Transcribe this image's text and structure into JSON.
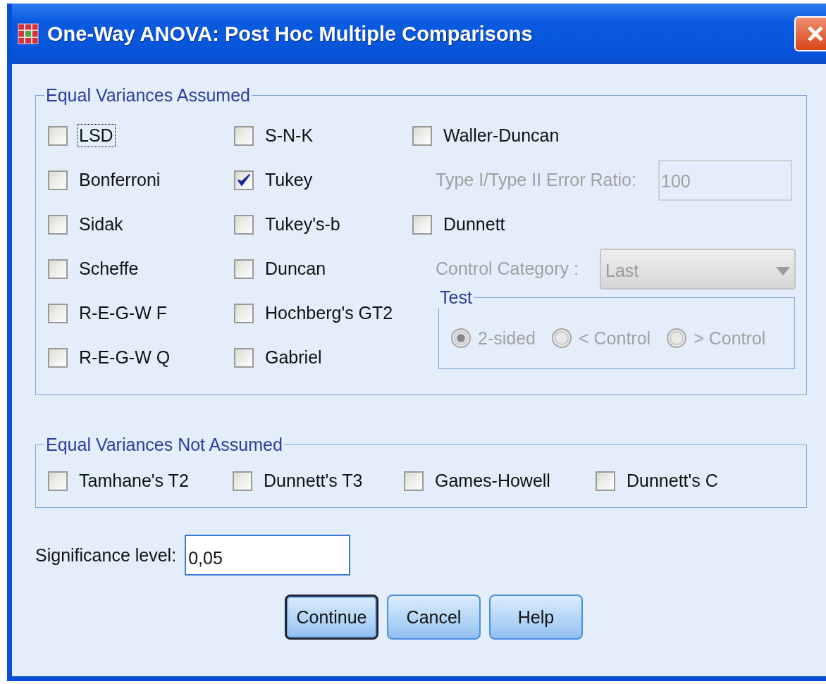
{
  "window": {
    "title": "One-Way ANOVA: Post Hoc Multiple Comparisons"
  },
  "equal_variances_assumed": {
    "title": "Equal Variances Assumed",
    "columns": [
      [
        {
          "label": "LSD",
          "checked": false,
          "focused": true
        },
        {
          "label": "Bonferroni",
          "checked": false,
          "focused": false
        },
        {
          "label": "Sidak",
          "checked": false,
          "focused": false
        },
        {
          "label": "Scheffe",
          "checked": false,
          "focused": false
        },
        {
          "label": "R-E-G-W F",
          "checked": false,
          "focused": false
        },
        {
          "label": "R-E-G-W Q",
          "checked": false,
          "focused": false
        }
      ],
      [
        {
          "label": "S-N-K",
          "checked": false,
          "focused": false
        },
        {
          "label": "Tukey",
          "checked": true,
          "focused": false
        },
        {
          "label": "Tukey's-b",
          "checked": false,
          "focused": false
        },
        {
          "label": "Duncan",
          "checked": false,
          "focused": false
        },
        {
          "label": "Hochberg's GT2",
          "checked": false,
          "focused": false
        },
        {
          "label": "Gabriel",
          "checked": false,
          "focused": false
        }
      ]
    ],
    "waller_duncan": {
      "label": "Waller-Duncan",
      "checked": false
    },
    "error_ratio": {
      "label": "Type I/Type II Error Ratio:",
      "value": "100",
      "disabled": true
    },
    "dunnett": {
      "label": "Dunnett",
      "checked": false
    },
    "control_category": {
      "label": "Control Category :",
      "value": "Last",
      "disabled": true
    },
    "test": {
      "title": "Test",
      "disabled": true,
      "options": [
        {
          "label": "2-sided",
          "selected": true
        },
        {
          "label": "< Control",
          "selected": false
        },
        {
          "label": "> Control",
          "selected": false
        }
      ]
    }
  },
  "equal_variances_not_assumed": {
    "title": "Equal Variances Not Assumed",
    "options": [
      {
        "label": "Tamhane's T2",
        "checked": false
      },
      {
        "label": "Dunnett's T3",
        "checked": false
      },
      {
        "label": "Games-Howell",
        "checked": false
      },
      {
        "label": "Dunnett's C",
        "checked": false
      }
    ]
  },
  "significance_level": {
    "label": "Significance level:",
    "value": "0,05"
  },
  "buttons": [
    {
      "label": "Continue",
      "default": true
    },
    {
      "label": "Cancel",
      "default": false
    },
    {
      "label": "Help",
      "default": false
    }
  ]
}
